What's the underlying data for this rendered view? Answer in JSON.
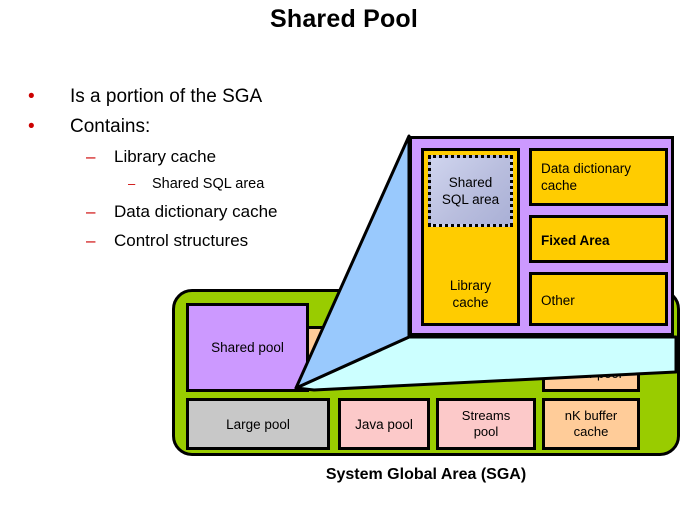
{
  "slide": {
    "title": "Shared Pool",
    "bullets": [
      {
        "level": 1,
        "marker": "•",
        "text": "Is a portion of the SGA"
      },
      {
        "level": 1,
        "marker": "•",
        "text": "Contains:"
      },
      {
        "level": 2,
        "marker": "–",
        "text": "Library cache"
      },
      {
        "level": 3,
        "marker": "–",
        "text": "Shared SQL area"
      },
      {
        "level": 2,
        "marker": "–",
        "text": "Data dictionary cache"
      },
      {
        "level": 2,
        "marker": "–",
        "text": "Control structures"
      }
    ]
  },
  "callout": {
    "name": "shared-pool-detail",
    "frame_color": "#cc99ff",
    "boxes": [
      {
        "id": "library-cache",
        "label": "Library\ncache",
        "color": "#ffcc00"
      },
      {
        "id": "shared-sql-area",
        "label": "Shared\nSQL area",
        "color": "#c3c8e6"
      },
      {
        "id": "data-dictionary-cache",
        "label": "Data dictionary\ncache",
        "color": "#ffcc00"
      },
      {
        "id": "fixed-area",
        "label": "Fixed Area",
        "color": "#ffcc00"
      },
      {
        "id": "other",
        "label": "Other",
        "color": "#ffcc00"
      }
    ]
  },
  "sga": {
    "caption": "System Global Area (SGA)",
    "container_color": "#99cc00",
    "components": [
      {
        "id": "shared-pool",
        "label": "Shared pool",
        "color": "#cc99ff"
      },
      {
        "id": "large-pool",
        "label": "Large pool",
        "color": "#c8c8c8"
      },
      {
        "id": "java-pool",
        "label": "Java pool",
        "color": "#fcc9c9"
      },
      {
        "id": "streams-pool",
        "label": "Streams\npool",
        "color": "#fcc9c9"
      },
      {
        "id": "recycle-buffer-pool",
        "label": "RECYCLE\nbuffer pool",
        "color": "#ffcc99"
      },
      {
        "id": "nk-buffer-cache",
        "label": "nK buffer\ncache",
        "color": "#ffcc99"
      }
    ],
    "occluded_components": [
      {
        "id": "occluded-peach-block",
        "color": "#ffcc99"
      },
      {
        "id": "occluded-yellow-block",
        "color": "#ffff99"
      },
      {
        "id": "occluded-peach-block-right",
        "color": "#ffcc99"
      }
    ]
  },
  "connector": {
    "top_face_color": "#99c9fd",
    "bottom_face_color": "#ccffff"
  }
}
